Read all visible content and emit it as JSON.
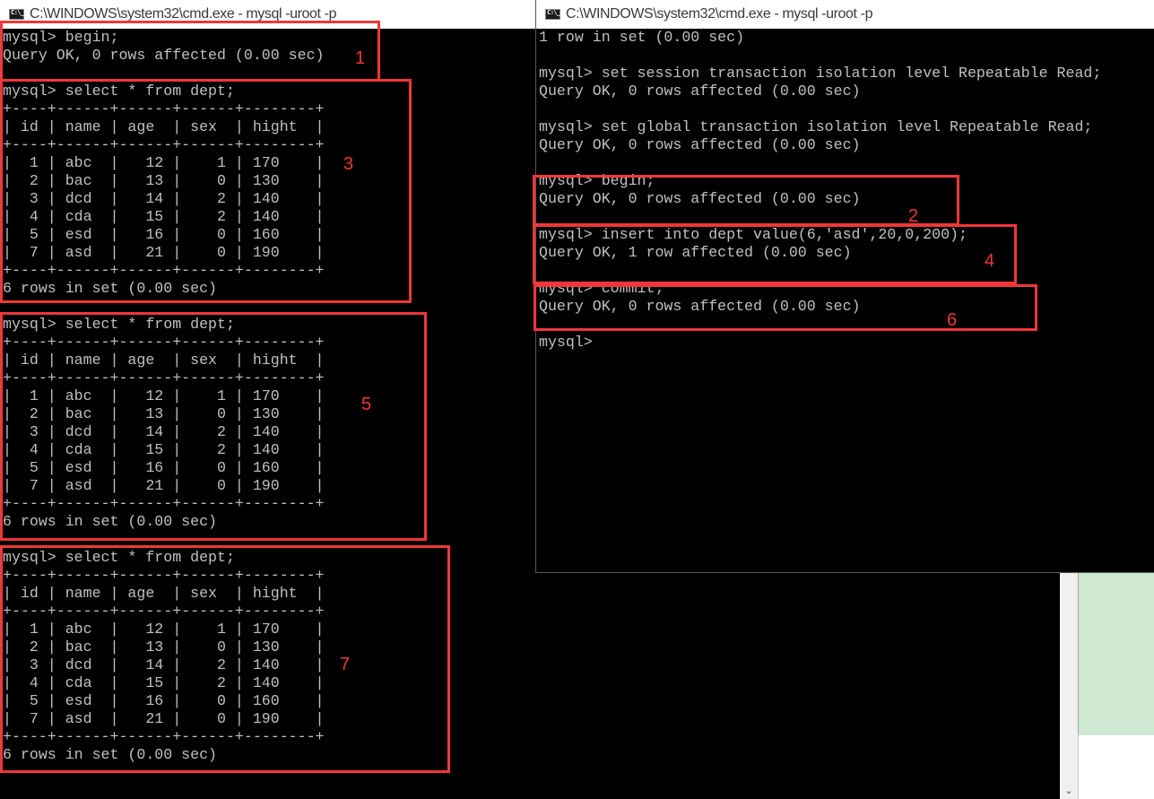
{
  "window_left": {
    "title": "C:\\WINDOWS\\system32\\cmd.exe - mysql  -uroot -p",
    "icon": "cmd-console-icon",
    "lines": [
      "mysql> begin;",
      "Query OK, 0 rows affected (0.00 sec)",
      "",
      "mysql> select * from dept;",
      "+----+------+------+------+--------+",
      "| id | name | age  | sex  | hight  |",
      "+----+------+------+------+--------+",
      "|  1 | abc  |   12 |    1 | 170    |",
      "|  2 | bac  |   13 |    0 | 130    |",
      "|  3 | dcd  |   14 |    2 | 140    |",
      "|  4 | cda  |   15 |    2 | 140    |",
      "|  5 | esd  |   16 |    0 | 160    |",
      "|  7 | asd  |   21 |    0 | 190    |",
      "+----+------+------+------+--------+",
      "6 rows in set (0.00 sec)",
      "",
      "mysql> select * from dept;",
      "+----+------+------+------+--------+",
      "| id | name | age  | sex  | hight  |",
      "+----+------+------+------+--------+",
      "|  1 | abc  |   12 |    1 | 170    |",
      "|  2 | bac  |   13 |    0 | 130    |",
      "|  3 | dcd  |   14 |    2 | 140    |",
      "|  4 | cda  |   15 |    2 | 140    |",
      "|  5 | esd  |   16 |    0 | 160    |",
      "|  7 | asd  |   21 |    0 | 190    |",
      "+----+------+------+------+--------+",
      "6 rows in set (0.00 sec)",
      "",
      "mysql> select * from dept;",
      "+----+------+------+------+--------+",
      "| id | name | age  | sex  | hight  |",
      "+----+------+------+------+--------+",
      "|  1 | abc  |   12 |    1 | 170    |",
      "|  2 | bac  |   13 |    0 | 130    |",
      "|  3 | dcd  |   14 |    2 | 140    |",
      "|  4 | cda  |   15 |    2 | 140    |",
      "|  5 | esd  |   16 |    0 | 160    |",
      "|  7 | asd  |   21 |    0 | 190    |",
      "+----+------+------+------+--------+",
      "6 rows in set (0.00 sec)"
    ]
  },
  "window_right": {
    "title": "C:\\WINDOWS\\system32\\cmd.exe - mysql  -uroot -p",
    "icon": "cmd-console-icon",
    "lines": [
      "1 row in set (0.00 sec)",
      "",
      "mysql> set session transaction isolation level Repeatable Read;",
      "Query OK, 0 rows affected (0.00 sec)",
      "",
      "mysql> set global transaction isolation level Repeatable Read;",
      "Query OK, 0 rows affected (0.00 sec)",
      "",
      "mysql> begin;",
      "Query OK, 0 rows affected (0.00 sec)",
      "",
      "mysql> insert into dept value(6,'asd',20,0,200);",
      "Query OK, 1 row affected (0.00 sec)",
      "",
      "mysql> commit;",
      "Query OK, 0 rows affected (0.00 sec)",
      "",
      "mysql>"
    ]
  },
  "annotations": [
    {
      "label": "1",
      "color": "#f0373a"
    },
    {
      "label": "2",
      "color": "#f0373a"
    },
    {
      "label": "3",
      "color": "#f0373a"
    },
    {
      "label": "4",
      "color": "#f0373a"
    },
    {
      "label": "5",
      "color": "#f0373a"
    },
    {
      "label": "6",
      "color": "#f0373a"
    },
    {
      "label": "7",
      "color": "#f0373a"
    }
  ],
  "scrollbar": {
    "down_arrow": "⌄"
  }
}
